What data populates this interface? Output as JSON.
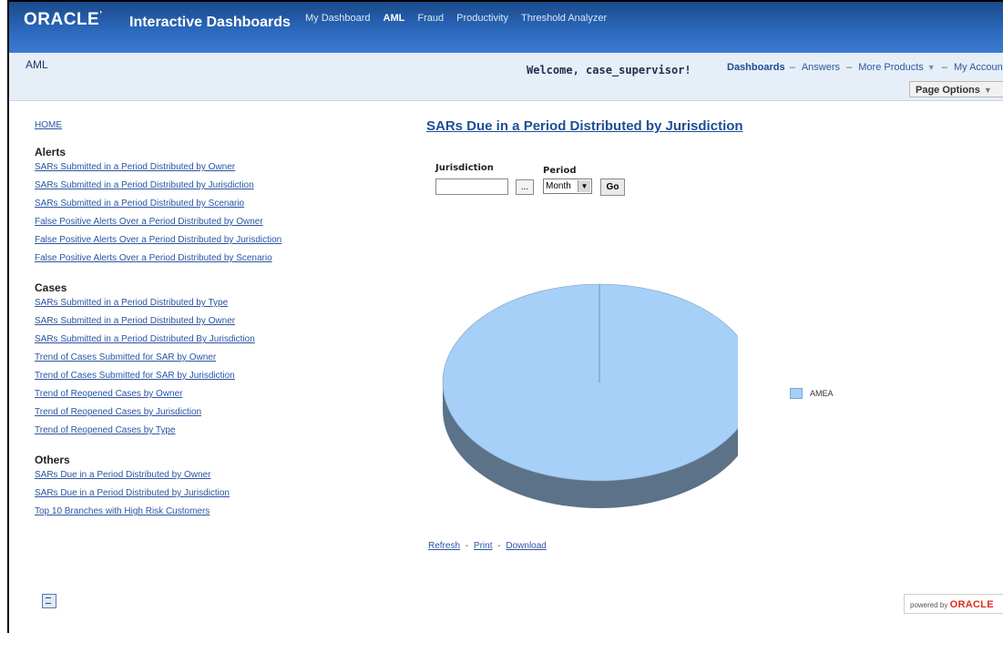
{
  "header": {
    "brand": "ORACLE",
    "product": "Interactive Dashboards",
    "nav": [
      "My Dashboard",
      "AML",
      "Fraud",
      "Productivity",
      "Threshold Analyzer"
    ],
    "active_nav": "AML",
    "brand_color": "#2a5fae"
  },
  "subheader": {
    "context": "AML",
    "welcome": "Welcome, case_supervisor!",
    "links": [
      "Dashboards",
      "Answers",
      "More Products",
      "My Account"
    ],
    "separator": "–",
    "page_options": "Page Options"
  },
  "sidebar": {
    "home": "HOME",
    "sections": [
      {
        "title": "Alerts",
        "items": [
          "SARs Submitted in a Period Distributed by Owner",
          "SARs Submitted in a Period Distributed by Jurisdiction",
          "SARs Submitted in a Period Distributed by Scenario",
          "False Positive Alerts Over a Period Distributed by Owner",
          "False Positive Alerts Over a Period Distributed by Jurisdiction",
          "False Positive Alerts Over a Period Distributed by Scenario"
        ]
      },
      {
        "title": "Cases",
        "items": [
          "SARs Submitted in a Period Distributed by Type",
          "SARs Submitted in a Period Distributed by Owner",
          "SARs Submitted in a Period Distributed By Jurisdiction",
          "Trend of Cases Submitted for SAR by Owner",
          "Trend of Cases Submitted for SAR by Jurisdiction",
          "Trend of Reopened Cases by Owner",
          "Trend of Reopened Cases by Jurisdiction",
          "Trend of Reopened Cases by Type"
        ]
      },
      {
        "title": "Others",
        "items": [
          "SARs Due in a Period Distributed by Owner",
          "SARs Due in a Period Distributed by Jurisdiction",
          "Top 10 Branches with High Risk Customers"
        ]
      }
    ]
  },
  "report": {
    "title": "SARs Due in a Period Distributed by Jurisdiction",
    "prompts": {
      "jurisdiction_label": "Jurisdiction",
      "jurisdiction_value": "",
      "browse_label": "...",
      "period_label": "Period",
      "period_value": "Month",
      "go_label": "Go"
    },
    "links": [
      "Refresh",
      "Print",
      "Download"
    ],
    "link_separator": "-"
  },
  "chart_data": {
    "type": "pie",
    "labels": [
      "AMEA"
    ],
    "values": [
      100
    ],
    "colors": [
      "#a6d0f8"
    ],
    "legend_position": "right"
  },
  "footer": {
    "powered_by": "powered by",
    "powered_brand": "ORACLE"
  }
}
